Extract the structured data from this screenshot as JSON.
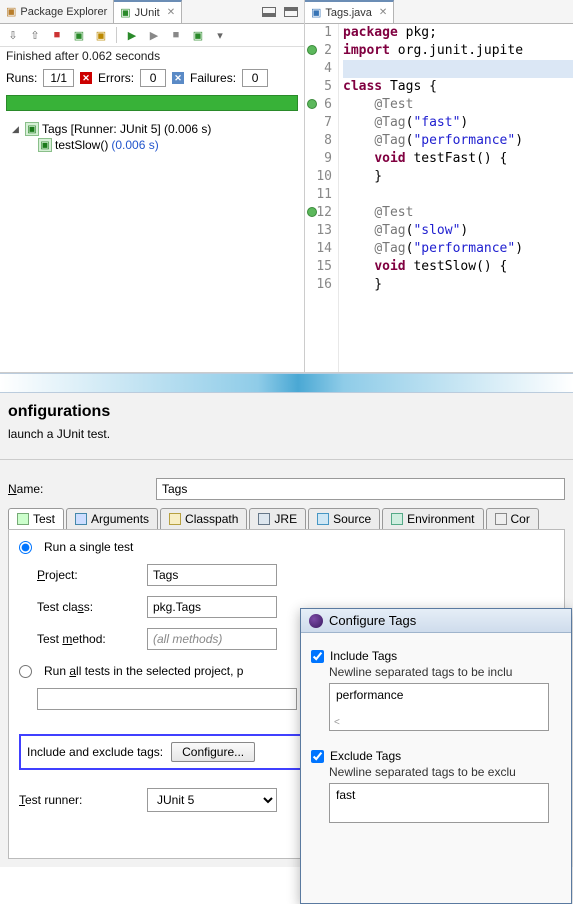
{
  "tabs": {
    "package_explorer": "Package Explorer",
    "junit": "JUnit",
    "editor_file": "Tags.java"
  },
  "junit": {
    "status": "Finished after 0.062 seconds",
    "runs_label": "Runs:",
    "runs_value": "1/1",
    "errors_label": "Errors:",
    "errors_value": "0",
    "failures_label": "Failures:",
    "failures_value": "0",
    "tree_root": "Tags [Runner: JUnit 5] (0.006 s)",
    "tree_child": "testSlow()",
    "tree_child_time": "(0.006 s)"
  },
  "code": {
    "l1": "package pkg;",
    "l2": "import org.junit.jupite",
    "l3": "",
    "l4": "class Tags {",
    "l5": "    @Test",
    "l6": "    @Tag(\"fast\")",
    "l7": "    @Tag(\"performance\")",
    "l8": "    void testFast() {",
    "l9": "    }",
    "l10": "",
    "l11": "    @Test",
    "l12": "    @Tag(\"slow\")",
    "l13": "    @Tag(\"performance\")",
    "l14": "    void testSlow() {",
    "l15": "    }"
  },
  "lines": {
    "n1": "1",
    "n2": "2",
    "n3": "4",
    "n4": "5",
    "n5": "6",
    "n6": "7",
    "n7": "8",
    "n8": "9",
    "n9": "10",
    "n10": "11",
    "n11": "12",
    "n12": "13",
    "n13": "14",
    "n14": "15",
    "n15": "16"
  },
  "config": {
    "title": "onfigurations",
    "subtitle": "launch a JUnit test.",
    "name_label": "Name:",
    "name_value": "Tags",
    "tabs": {
      "test": "Test",
      "arguments": "Arguments",
      "classpath": "Classpath",
      "jre": "JRE",
      "source": "Source",
      "environment": "Environment",
      "common": "Cor"
    },
    "form": {
      "run_single": "Run a single test",
      "project_label": "Project:",
      "project_value": "Tags",
      "class_label": "Test class:",
      "class_value": "pkg.Tags",
      "method_label": "Test method:",
      "method_placeholder": "(all methods)",
      "run_all": "Run all tests in the selected project, p",
      "include_exclude": "Include and exclude tags:",
      "configure_btn": "Configure...",
      "runner_label": "Test runner:",
      "runner_value": "JUnit 5"
    }
  },
  "overlay": {
    "title": "Configure Tags",
    "include_chk": "Include Tags",
    "include_hint": "Newline separated tags to be inclu",
    "include_value": "performance",
    "exclude_chk": "Exclude Tags",
    "exclude_hint": "Newline separated tags to be exclu",
    "exclude_value": "fast"
  }
}
